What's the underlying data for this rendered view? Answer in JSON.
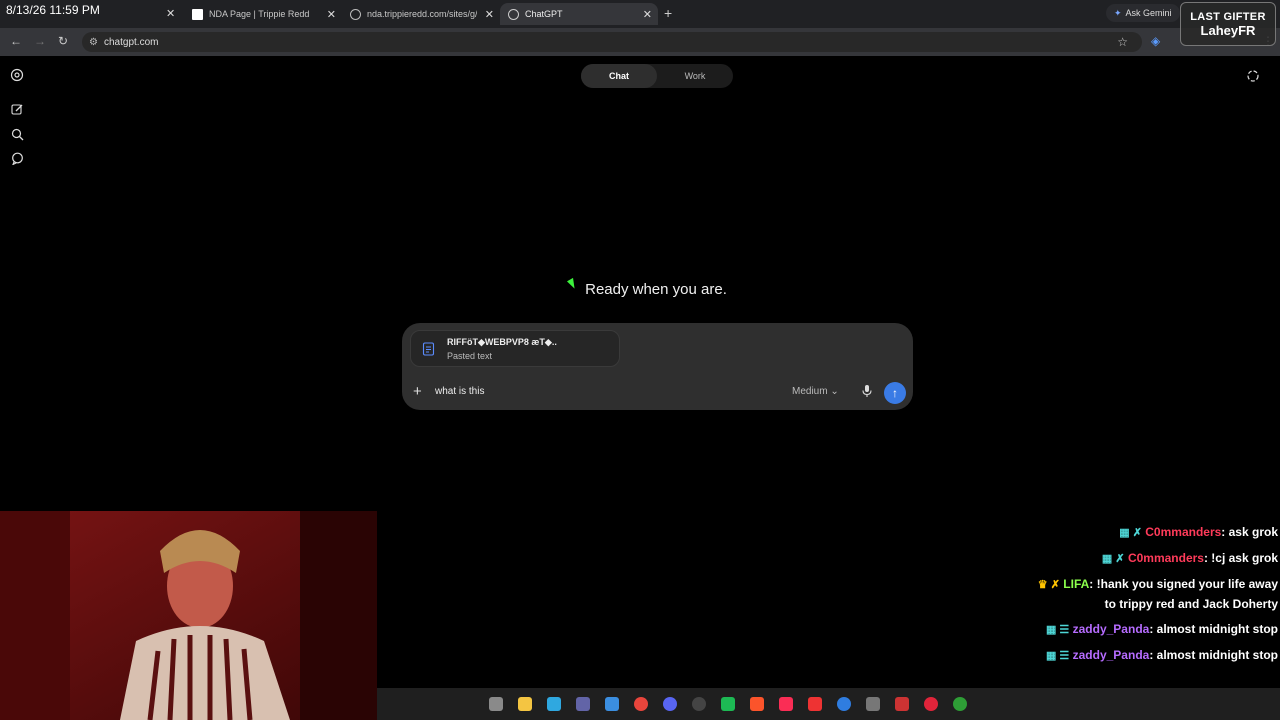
{
  "overlay": {
    "timestamp": "8/13/26 11:59 PM",
    "last_gifter_label": "LAST GIFTER",
    "last_gifter_name": "LaheyFR"
  },
  "browser": {
    "tabs": [
      {
        "title": "NDA Page | Trippie Redd",
        "active": false
      },
      {
        "title": "nda.trippieredd.com/sites/g/file",
        "active": false
      },
      {
        "title": "ChatGPT",
        "active": true
      }
    ],
    "url": "chatgpt.com",
    "ask_gemini": "Ask Gemini"
  },
  "chatgpt": {
    "mode_tabs": [
      {
        "label": "Chat",
        "selected": true
      },
      {
        "label": "Work",
        "selected": false
      }
    ],
    "headline": "Ready when you are.",
    "attachment": {
      "name": "RIFFöT⁣◆WEBPVP8 æT⁣◆..",
      "type": "Pasted text"
    },
    "prompt_text": "what is this",
    "model_selector": "Medium"
  },
  "stream_chat": [
    {
      "user": "C0mmanders",
      "color": "red",
      "text": ": ask grok"
    },
    {
      "user": "C0mmanders",
      "color": "red",
      "text": ": !cj ask grok"
    },
    {
      "user": "LIFA",
      "color": "green",
      "text": ": !hank you signed your life away to trippy red and Jack Doherty"
    },
    {
      "user": "zaddy_Panda",
      "color": "purple",
      "text": ": almost midnight stop"
    },
    {
      "user": "zaddy_Panda",
      "color": "purple",
      "text": ": almost midnight stop"
    }
  ],
  "icons": {
    "sidebar": [
      "openai-logo-icon",
      "new-chat-icon",
      "search-icon",
      "chat-bubble-icon"
    ],
    "composer": [
      "plus-icon",
      "mic-icon",
      "send-arrow-icon"
    ]
  }
}
